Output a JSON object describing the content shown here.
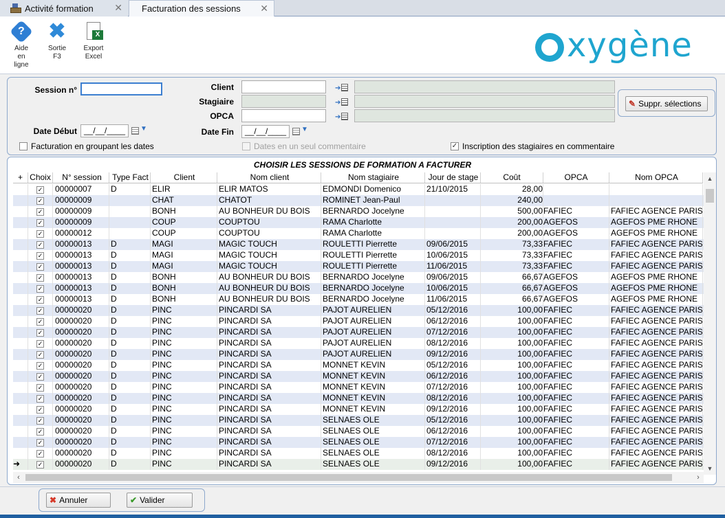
{
  "tabs": [
    {
      "label": "Activité formation",
      "active": false
    },
    {
      "label": "Facturation des sessions",
      "active": true
    }
  ],
  "toolbar": {
    "help": {
      "line1": "Aide",
      "line2": "en",
      "line3": "ligne"
    },
    "exit": {
      "line1": "Sortie",
      "line2": "F3"
    },
    "export": {
      "line1": "Export",
      "line2": "Excel"
    }
  },
  "logo": {
    "text": "xygène"
  },
  "filters": {
    "session_label": "Session n°",
    "session_value": "",
    "client_label": "Client",
    "client_code": "",
    "client_name": "",
    "stagiaire_label": "Stagiaire",
    "opca_label": "OPCA",
    "date_debut_label": "Date Début",
    "date_debut_value": "__/__/____",
    "date_fin_label": "Date Fin",
    "date_fin_value": "__/__/____",
    "group_dates_label": "Facturation en groupant les dates",
    "group_dates_checked": false,
    "single_comment_label": "Dates en un seul commentaire",
    "single_comment_checked": false,
    "inscription_label": "Inscription des stagiaires en commentaire",
    "inscription_checked": true,
    "suppr_label": "Suppr. sélections"
  },
  "grid": {
    "title": "CHOISIR LES SESSIONS DE FORMATION A FACTURER",
    "columns": [
      "",
      "Choix",
      "N° session",
      "Type Fact",
      "Client",
      "Nom client",
      "Nom stagiaire",
      "Jour de stage",
      "Coût",
      "OPCA",
      "Nom OPCA"
    ],
    "rows": [
      {
        "marker": "",
        "checked": true,
        "session": "00000007",
        "type": "D",
        "client": "ELIR",
        "nom_client": "ELIR MATOS",
        "stagiaire": "EDMONDI Domenico",
        "jour": "21/10/2015",
        "cout": "28,00",
        "opca": "",
        "nom_opca": ""
      },
      {
        "marker": "",
        "checked": true,
        "session": "00000009",
        "type": "",
        "client": "CHAT",
        "nom_client": "CHATOT",
        "stagiaire": "ROMINET Jean-Paul",
        "jour": "",
        "cout": "240,00",
        "opca": "",
        "nom_opca": ""
      },
      {
        "marker": "",
        "checked": true,
        "session": "00000009",
        "type": "",
        "client": "BONH",
        "nom_client": "AU BONHEUR DU BOIS",
        "stagiaire": "BERNARDO Jocelyne",
        "jour": "",
        "cout": "500,00",
        "opca": "FAFIEC",
        "nom_opca": "FAFIEC AGENCE PARIS"
      },
      {
        "marker": "",
        "checked": true,
        "session": "00000009",
        "type": "",
        "client": "COUP",
        "nom_client": "COUPTOU",
        "stagiaire": "RAMA Charlotte",
        "jour": "",
        "cout": "200,00",
        "opca": "AGEFOS",
        "nom_opca": "AGEFOS PME RHONE"
      },
      {
        "marker": "",
        "checked": true,
        "session": "00000012",
        "type": "",
        "client": "COUP",
        "nom_client": "COUPTOU",
        "stagiaire": "RAMA Charlotte",
        "jour": "",
        "cout": "200,00",
        "opca": "AGEFOS",
        "nom_opca": "AGEFOS PME RHONE"
      },
      {
        "marker": "",
        "checked": true,
        "session": "00000013",
        "type": "D",
        "client": "MAGI",
        "nom_client": "MAGIC TOUCH",
        "stagiaire": "ROULETTI Pierrette",
        "jour": "09/06/2015",
        "cout": "73,33",
        "opca": "FAFIEC",
        "nom_opca": "FAFIEC AGENCE PARIS"
      },
      {
        "marker": "",
        "checked": true,
        "session": "00000013",
        "type": "D",
        "client": "MAGI",
        "nom_client": "MAGIC TOUCH",
        "stagiaire": "ROULETTI Pierrette",
        "jour": "10/06/2015",
        "cout": "73,33",
        "opca": "FAFIEC",
        "nom_opca": "FAFIEC AGENCE PARIS"
      },
      {
        "marker": "",
        "checked": true,
        "session": "00000013",
        "type": "D",
        "client": "MAGI",
        "nom_client": "MAGIC TOUCH",
        "stagiaire": "ROULETTI Pierrette",
        "jour": "11/06/2015",
        "cout": "73,33",
        "opca": "FAFIEC",
        "nom_opca": "FAFIEC AGENCE PARIS"
      },
      {
        "marker": "",
        "checked": true,
        "session": "00000013",
        "type": "D",
        "client": "BONH",
        "nom_client": "AU BONHEUR DU BOIS",
        "stagiaire": "BERNARDO Jocelyne",
        "jour": "09/06/2015",
        "cout": "66,67",
        "opca": "AGEFOS",
        "nom_opca": "AGEFOS PME RHONE"
      },
      {
        "marker": "",
        "checked": true,
        "session": "00000013",
        "type": "D",
        "client": "BONH",
        "nom_client": "AU BONHEUR DU BOIS",
        "stagiaire": "BERNARDO Jocelyne",
        "jour": "10/06/2015",
        "cout": "66,67",
        "opca": "AGEFOS",
        "nom_opca": "AGEFOS PME RHONE"
      },
      {
        "marker": "",
        "checked": true,
        "session": "00000013",
        "type": "D",
        "client": "BONH",
        "nom_client": "AU BONHEUR DU BOIS",
        "stagiaire": "BERNARDO Jocelyne",
        "jour": "11/06/2015",
        "cout": "66,67",
        "opca": "AGEFOS",
        "nom_opca": "AGEFOS PME RHONE"
      },
      {
        "marker": "",
        "checked": true,
        "session": "00000020",
        "type": "D",
        "client": "PINC",
        "nom_client": "PINCARDI SA",
        "stagiaire": "PAJOT AURELIEN",
        "jour": "05/12/2016",
        "cout": "100,00",
        "opca": "FAFIEC",
        "nom_opca": "FAFIEC AGENCE PARIS"
      },
      {
        "marker": "",
        "checked": true,
        "session": "00000020",
        "type": "D",
        "client": "PINC",
        "nom_client": "PINCARDI SA",
        "stagiaire": "PAJOT AURELIEN",
        "jour": "06/12/2016",
        "cout": "100,00",
        "opca": "FAFIEC",
        "nom_opca": "FAFIEC AGENCE PARIS"
      },
      {
        "marker": "",
        "checked": true,
        "session": "00000020",
        "type": "D",
        "client": "PINC",
        "nom_client": "PINCARDI SA",
        "stagiaire": "PAJOT AURELIEN",
        "jour": "07/12/2016",
        "cout": "100,00",
        "opca": "FAFIEC",
        "nom_opca": "FAFIEC AGENCE PARIS"
      },
      {
        "marker": "",
        "checked": true,
        "session": "00000020",
        "type": "D",
        "client": "PINC",
        "nom_client": "PINCARDI SA",
        "stagiaire": "PAJOT AURELIEN",
        "jour": "08/12/2016",
        "cout": "100,00",
        "opca": "FAFIEC",
        "nom_opca": "FAFIEC AGENCE PARIS"
      },
      {
        "marker": "",
        "checked": true,
        "session": "00000020",
        "type": "D",
        "client": "PINC",
        "nom_client": "PINCARDI SA",
        "stagiaire": "PAJOT AURELIEN",
        "jour": "09/12/2016",
        "cout": "100,00",
        "opca": "FAFIEC",
        "nom_opca": "FAFIEC AGENCE PARIS"
      },
      {
        "marker": "",
        "checked": true,
        "session": "00000020",
        "type": "D",
        "client": "PINC",
        "nom_client": "PINCARDI SA",
        "stagiaire": "MONNET KEVIN",
        "jour": "05/12/2016",
        "cout": "100,00",
        "opca": "FAFIEC",
        "nom_opca": "FAFIEC AGENCE PARIS"
      },
      {
        "marker": "",
        "checked": true,
        "session": "00000020",
        "type": "D",
        "client": "PINC",
        "nom_client": "PINCARDI SA",
        "stagiaire": "MONNET KEVIN",
        "jour": "06/12/2016",
        "cout": "100,00",
        "opca": "FAFIEC",
        "nom_opca": "FAFIEC AGENCE PARIS"
      },
      {
        "marker": "",
        "checked": true,
        "session": "00000020",
        "type": "D",
        "client": "PINC",
        "nom_client": "PINCARDI SA",
        "stagiaire": "MONNET KEVIN",
        "jour": "07/12/2016",
        "cout": "100,00",
        "opca": "FAFIEC",
        "nom_opca": "FAFIEC AGENCE PARIS"
      },
      {
        "marker": "",
        "checked": true,
        "session": "00000020",
        "type": "D",
        "client": "PINC",
        "nom_client": "PINCARDI SA",
        "stagiaire": "MONNET KEVIN",
        "jour": "08/12/2016",
        "cout": "100,00",
        "opca": "FAFIEC",
        "nom_opca": "FAFIEC AGENCE PARIS"
      },
      {
        "marker": "",
        "checked": true,
        "session": "00000020",
        "type": "D",
        "client": "PINC",
        "nom_client": "PINCARDI SA",
        "stagiaire": "MONNET KEVIN",
        "jour": "09/12/2016",
        "cout": "100,00",
        "opca": "FAFIEC",
        "nom_opca": "FAFIEC AGENCE PARIS"
      },
      {
        "marker": "",
        "checked": true,
        "session": "00000020",
        "type": "D",
        "client": "PINC",
        "nom_client": "PINCARDI SA",
        "stagiaire": "SELNAES OLE",
        "jour": "05/12/2016",
        "cout": "100,00",
        "opca": "FAFIEC",
        "nom_opca": "FAFIEC AGENCE PARIS"
      },
      {
        "marker": "",
        "checked": true,
        "session": "00000020",
        "type": "D",
        "client": "PINC",
        "nom_client": "PINCARDI SA",
        "stagiaire": "SELNAES OLE",
        "jour": "06/12/2016",
        "cout": "100,00",
        "opca": "FAFIEC",
        "nom_opca": "FAFIEC AGENCE PARIS"
      },
      {
        "marker": "",
        "checked": true,
        "session": "00000020",
        "type": "D",
        "client": "PINC",
        "nom_client": "PINCARDI SA",
        "stagiaire": "SELNAES OLE",
        "jour": "07/12/2016",
        "cout": "100,00",
        "opca": "FAFIEC",
        "nom_opca": "FAFIEC AGENCE PARIS"
      },
      {
        "marker": "",
        "checked": true,
        "session": "00000020",
        "type": "D",
        "client": "PINC",
        "nom_client": "PINCARDI SA",
        "stagiaire": "SELNAES OLE",
        "jour": "08/12/2016",
        "cout": "100,00",
        "opca": "FAFIEC",
        "nom_opca": "FAFIEC AGENCE PARIS"
      },
      {
        "marker": "➜",
        "checked": true,
        "session": "00000020",
        "type": "D",
        "client": "PINC",
        "nom_client": "PINCARDI SA",
        "stagiaire": "SELNAES OLE",
        "jour": "09/12/2016",
        "cout": "100,00",
        "opca": "FAFIEC",
        "nom_opca": "FAFIEC AGENCE PARIS"
      }
    ]
  },
  "footer": {
    "cancel_label": "Annuler",
    "validate_label": "Valider"
  },
  "colors": {
    "accent": "#1fa5cf",
    "row_alt": "#e2e8f5",
    "border": "#8da8cc"
  }
}
